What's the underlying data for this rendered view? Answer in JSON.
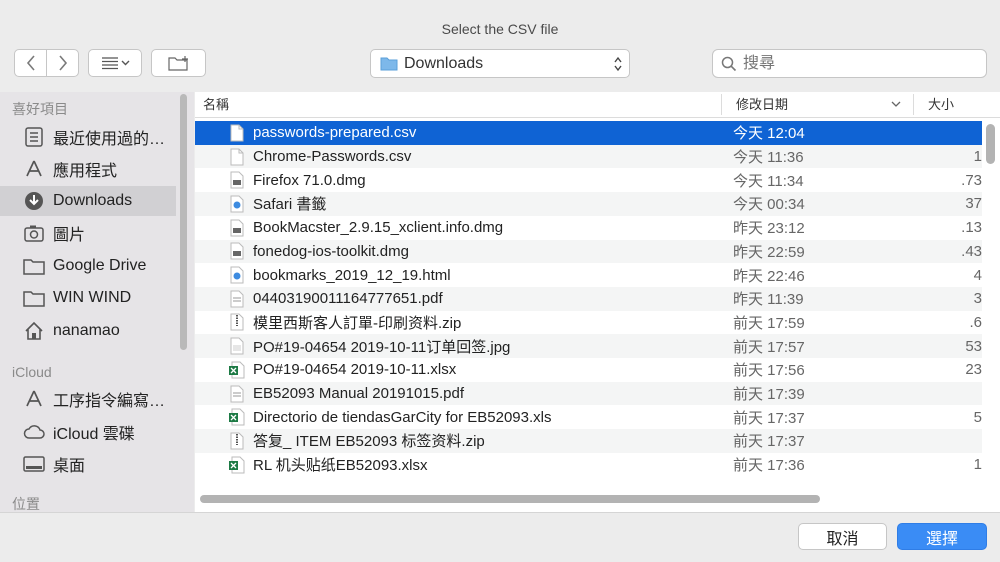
{
  "window": {
    "title": "Select the CSV file"
  },
  "toolbar": {
    "back_icon": "chevron-left-icon",
    "forward_icon": "chevron-right-icon",
    "view_icon": "list-view-icon",
    "new_folder_icon": "new-folder-icon",
    "location": "Downloads",
    "search_placeholder": "搜尋"
  },
  "sidebar": {
    "favorites_header": "喜好項目",
    "favorites": [
      {
        "label": "最近使用過的…",
        "icon": "recents-icon"
      },
      {
        "label": "應用程式",
        "icon": "applications-icon"
      },
      {
        "label": "Downloads",
        "icon": "downloads-icon",
        "selected": true
      },
      {
        "label": "圖片",
        "icon": "pictures-icon"
      },
      {
        "label": "Google Drive",
        "icon": "folder-icon"
      },
      {
        "label": "WIN WIND",
        "icon": "folder-icon"
      },
      {
        "label": "nanamao",
        "icon": "home-icon"
      }
    ],
    "icloud_header": "iCloud",
    "icloud": [
      {
        "label": "工序指令編寫…",
        "icon": "app-folder-icon"
      },
      {
        "label": "iCloud 雲碟",
        "icon": "cloud-icon"
      },
      {
        "label": "桌面",
        "icon": "desktop-icon"
      }
    ],
    "locations_header": "位置"
  },
  "columns": {
    "name": "名稱",
    "date": "修改日期",
    "size": "大小"
  },
  "files": [
    {
      "name": "passwords-prepared.csv",
      "date": "今天 12:04",
      "size": "",
      "type": "doc",
      "selected": true
    },
    {
      "name": "Chrome-Passwords.csv",
      "date": "今天 11:36",
      "size": "1",
      "type": "doc"
    },
    {
      "name": "Firefox 71.0.dmg",
      "date": "今天 11:34",
      "size": "73.",
      "type": "dmg"
    },
    {
      "name": "Safari 書籤",
      "date": "今天 00:34",
      "size": "37",
      "type": "html"
    },
    {
      "name": "BookMacster_2.9.15_xclient.info.dmg",
      "date": "昨天 23:12",
      "size": "13.",
      "type": "dmg"
    },
    {
      "name": "fonedog-ios-toolkit.dmg",
      "date": "昨天 22:59",
      "size": "43.",
      "type": "dmg"
    },
    {
      "name": "bookmarks_2019_12_19.html",
      "date": "昨天 22:46",
      "size": "4",
      "type": "html"
    },
    {
      "name": "04403190011164777651.pdf",
      "date": "昨天 11:39",
      "size": "3",
      "type": "pdf"
    },
    {
      "name": "模里西斯客人訂單-印刷资料.zip",
      "date": "前天 17:59",
      "size": "6.",
      "type": "zip"
    },
    {
      "name": "PO#19-04654 2019-10-11订单回签.jpg",
      "date": "前天 17:57",
      "size": "53",
      "type": "img"
    },
    {
      "name": "PO#19-04654 2019-10-11.xlsx",
      "date": "前天 17:56",
      "size": "23",
      "type": "xls"
    },
    {
      "name": "EB52093 Manual 20191015.pdf",
      "date": "前天 17:39",
      "size": "",
      "type": "pdf"
    },
    {
      "name": "Directorio de tiendasGarCity for EB52093.xls",
      "date": "前天 17:37",
      "size": "5",
      "type": "xls"
    },
    {
      "name": "答复_ ITEM EB52093  标签资料.zip",
      "date": "前天 17:37",
      "size": "",
      "type": "zip"
    },
    {
      "name": "RL 机头贴纸EB52093.xlsx",
      "date": "前天 17:36",
      "size": "1",
      "type": "xls"
    }
  ],
  "buttons": {
    "cancel": "取消",
    "ok": "選擇"
  },
  "colors": {
    "accent": "#0f63d4",
    "ok_button": "#3a8cf5",
    "sidebar_bg": "#e6e4e7"
  }
}
